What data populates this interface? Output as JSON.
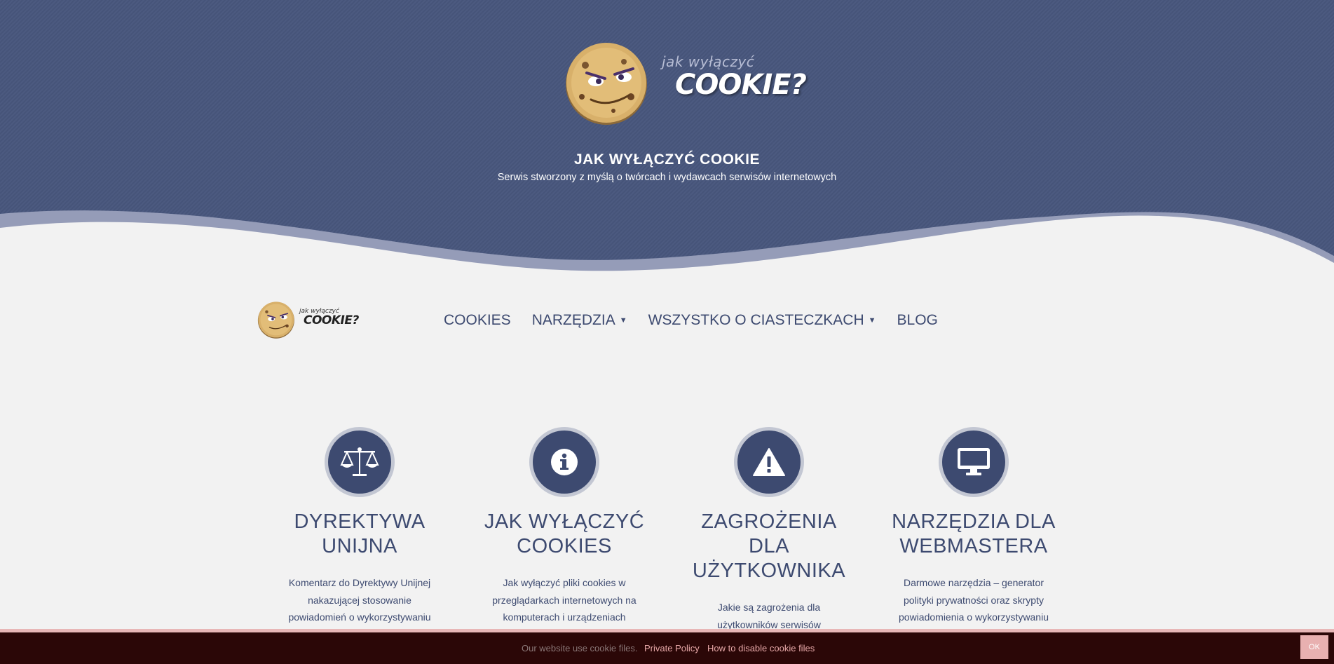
{
  "hero": {
    "logo_sub": "jak wyłączyć",
    "logo_main": "COOKIE?",
    "title": "JAK WYŁĄCZYĆ COOKIE",
    "subtitle": "Serwis stworzony z myślą o twórcach i wydawcach serwisów internetowych"
  },
  "nav": {
    "logo_sub": "jak wyłączyć",
    "logo_main": "COOKIE?",
    "items": [
      {
        "label": "COOKIES",
        "dropdown": false
      },
      {
        "label": "NARZĘDZIA",
        "dropdown": true
      },
      {
        "label": "WSZYSTKO O CIASTECZKACH",
        "dropdown": true
      },
      {
        "label": "BLOG",
        "dropdown": false
      }
    ]
  },
  "features": [
    {
      "icon": "scale-icon",
      "title": "DYREKTYWA UNIJNA",
      "desc": "Komentarz do Dyrektywy Unijnej nakazującej stosowanie powiadomień o wykorzystywaniu plików cookies."
    },
    {
      "icon": "info-icon",
      "title": "JAK WYŁĄCZYĆ COOKIES",
      "desc": "Jak wyłączyć pliki cookies w przeglądarkach internetowych na komputerach i urządzeniach"
    },
    {
      "icon": "warning-icon",
      "title": "ZAGROŻENIA DLA UŻYTKOWNIKA",
      "desc": "Jakie są zagrożenia dla użytkowników serwisów internetowych, którzy zezwalają na"
    },
    {
      "icon": "monitor-icon",
      "title": "NARZĘDZIA DLA WEBMASTERA",
      "desc": "Darmowe narzędzia – generator polityki prywatności oraz skrypty powiadomienia o wykorzystywaniu"
    }
  ],
  "cookie_bar": {
    "text": "Our website use cookie files.",
    "privacy_link": "Private Policy",
    "disable_link": "How to disable cookie files",
    "ok_label": "OK"
  },
  "colors": {
    "accent": "#3d4a70",
    "hero_bg": "#465479",
    "cookie_bar_bg": "#2b0707",
    "cookie_link": "#e7a8a8"
  }
}
